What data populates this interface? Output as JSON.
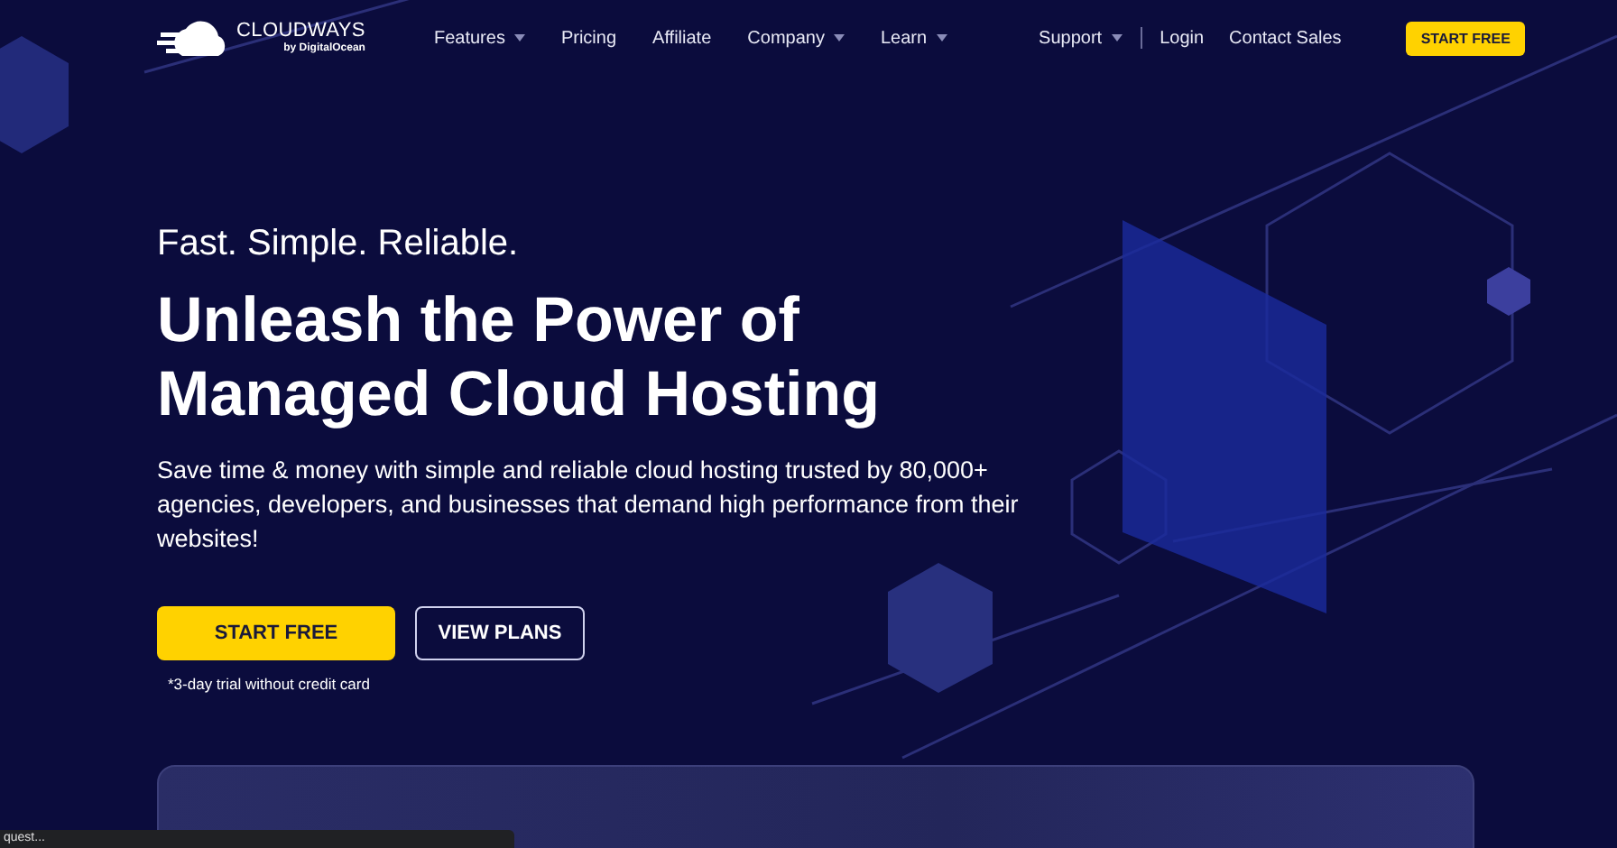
{
  "nav": {
    "brand": {
      "name": "CLOUDWAYS",
      "byline": "by DigitalOcean"
    },
    "links": [
      {
        "label": "Features",
        "dropdown": true
      },
      {
        "label": "Pricing",
        "dropdown": false
      },
      {
        "label": "Affiliate",
        "dropdown": false
      },
      {
        "label": "Company",
        "dropdown": true
      },
      {
        "label": "Learn",
        "dropdown": true
      }
    ],
    "right_links": [
      {
        "label": "Support",
        "dropdown": true
      },
      {
        "label": "Login",
        "dropdown": false
      },
      {
        "label": "Contact Sales",
        "dropdown": false
      }
    ],
    "cta": "START FREE"
  },
  "hero": {
    "tagline": "Fast. Simple. Reliable.",
    "headline": "Unleash the Power of Managed Cloud Hosting",
    "description": "Save time & money with simple and reliable cloud hosting trusted by 80,000+ agencies, developers, and businesses that demand high performance from their websites!",
    "primary_button": "START FREE",
    "secondary_button": "VIEW PLANS",
    "note": "*3-day trial without credit card"
  },
  "status_bubble": "quest..."
}
